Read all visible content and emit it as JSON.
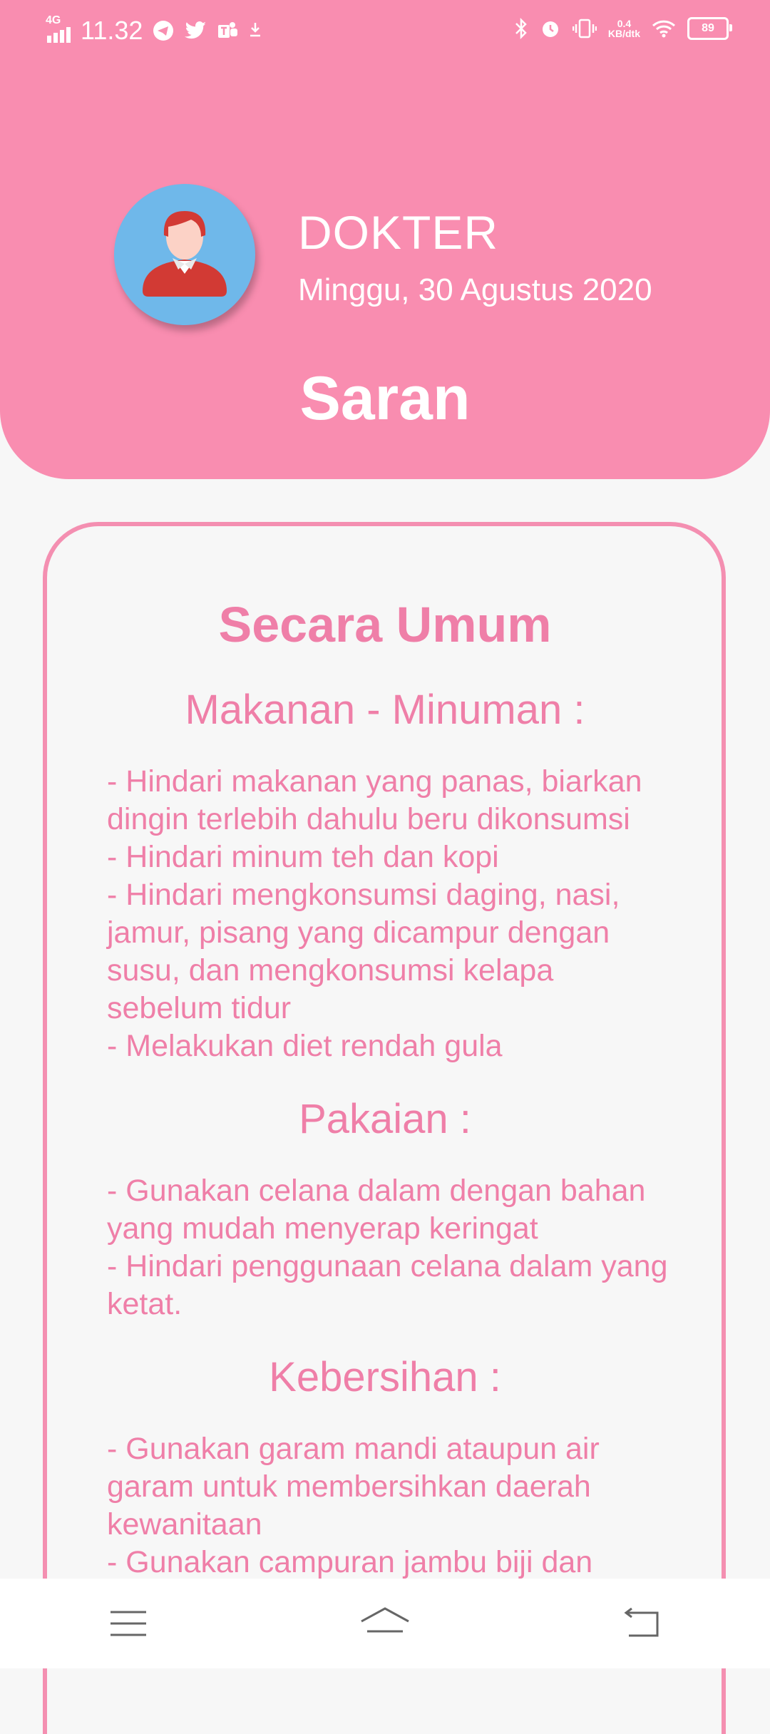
{
  "status_bar": {
    "network": "4G",
    "time": "11.32",
    "speed_value": "0.4",
    "speed_unit": "KB/dtk",
    "battery": "89",
    "left_icons": [
      "telegram-icon",
      "twitter-icon",
      "teams-icon",
      "download-icon"
    ],
    "right_icons": [
      "bluetooth-icon",
      "alarm-icon",
      "vibrate-icon",
      "wifi-icon",
      "battery-icon"
    ]
  },
  "header": {
    "role": "DOKTER",
    "date": "Minggu, 30 Agustus 2020",
    "title": "Saran"
  },
  "content": {
    "heading": "Secara Umum",
    "sections": [
      {
        "title": "Makanan - Minuman :",
        "items": [
          "- Hindari makanan yang panas, biarkan dingin terlebih dahulu beru dikonsumsi",
          "- Hindari minum teh dan kopi",
          "- Hindari mengkonsumsi daging, nasi, jamur, pisang yang dicampur dengan susu, dan mengkonsumsi kelapa sebelum tidur",
          "- Melakukan diet rendah gula"
        ]
      },
      {
        "title": "Pakaian :",
        "items": [
          "- Gunakan celana dalam dengan bahan yang mudah menyerap keringat",
          "- Hindari penggunaan celana dalam yang ketat."
        ]
      },
      {
        "title": "Kebersihan :",
        "items": [
          "- Gunakan garam mandi ataupun air garam untuk membersihkan daerah kewanitaan",
          "- Gunakan campuran jambu biji dan"
        ]
      }
    ]
  },
  "nav_bar": {
    "buttons": [
      "menu-icon",
      "home-icon",
      "back-icon"
    ]
  },
  "colors": {
    "header_bg": "#f98db0",
    "accent_text": "#ef7fa8",
    "page_bg": "#f7f7f7",
    "avatar_bg": "#6fb8ea"
  }
}
